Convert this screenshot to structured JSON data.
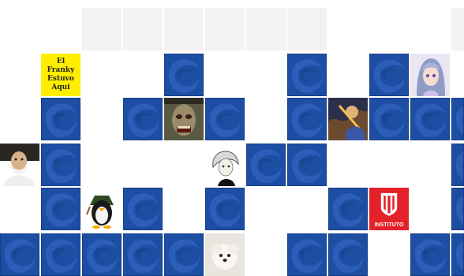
{
  "game": {
    "kind": "memory-card-board",
    "card_back_icon": "blue-swirl-card-back",
    "colors": {
      "card_back": "#1d4ea3",
      "header_cell": "#f3f2f1",
      "background": "#ffffff"
    }
  },
  "revealed": {
    "franky_note": "El\nFranky\nEstuvo\nAqui",
    "instituto_logo": "INSTITUTO"
  },
  "revealed_icons": [
    "anime-girl-portrait",
    "zombie-face",
    "fantasy-warrior",
    "old-man-portrait",
    "white-hair-anime",
    "penguin-mascot",
    "instituto-shield-logo",
    "white-puppy"
  ]
}
